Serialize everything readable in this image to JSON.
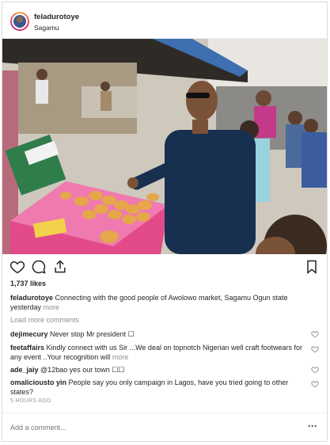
{
  "header": {
    "username": "feladurotoye",
    "location": "Sagamu"
  },
  "post": {
    "likes": "1,737 likes",
    "caption_user": "feladurotoye",
    "caption_text": "Connecting with the good people of Awolowo market, Sagamu Ogun state yesterday",
    "caption_more": "more",
    "load_more": "Load more comments",
    "timestamp": "5 HOURS AGO"
  },
  "comments": [
    {
      "user": "dejimecury",
      "text": "Never stop Mr president ☐",
      "more": ""
    },
    {
      "user": "feetaffairs",
      "text": "Kindly connect with us Sir ...We deal on topnotch Nigerian well craft footwears for any event ..Your recognition will",
      "more": "more"
    },
    {
      "user": "ade_jaiy",
      "text": "@12bao yes our town ☐☐",
      "more": ""
    },
    {
      "user": "omaliciousto yin",
      "text": "People say you only campaign in Lagos, have you tried going to other states?",
      "more": ""
    }
  ],
  "add_comment": {
    "placeholder": "Add a comment..."
  },
  "icons": [
    "heart-icon",
    "comment-icon",
    "share-icon",
    "bookmark-icon",
    "more-options-icon"
  ]
}
